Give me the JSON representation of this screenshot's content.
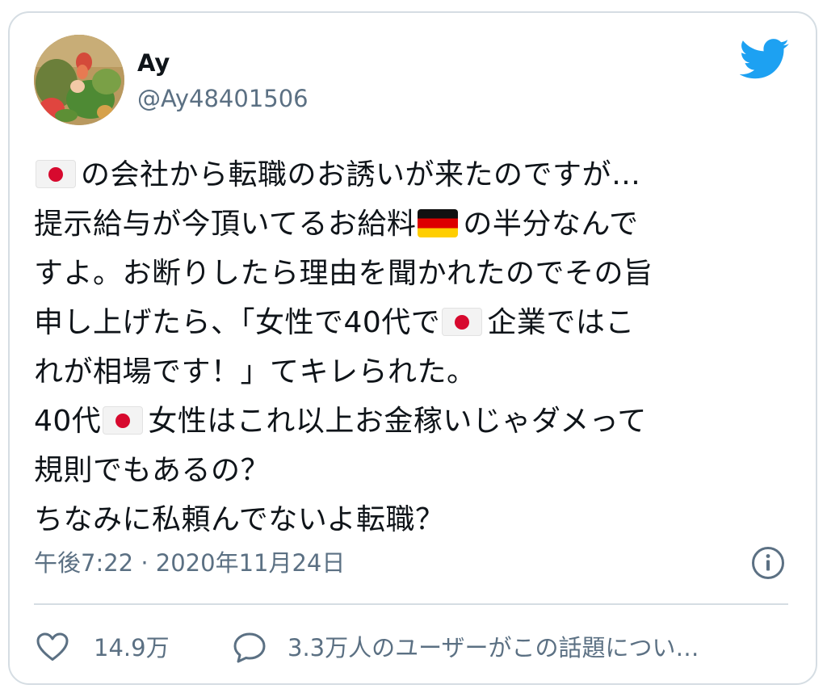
{
  "user": {
    "name": "Ay",
    "handle": "@Ay48401506"
  },
  "tweet": {
    "lines": [
      [
        "jp",
        "の会社から転職のお誘いが来たのですが…"
      ],
      [
        "",
        "提示給与が今頂いてるお給料",
        "de",
        "の半分なんで"
      ],
      [
        "",
        "すよ。お断りしたら理由を聞かれたのでその旨"
      ],
      [
        "",
        "申し上げたら、「女性で40代で",
        "jp",
        "企業ではこ"
      ],
      [
        "",
        "れが相場です！」てキレられた。"
      ],
      [
        "",
        "40代",
        "jp",
        "女性はこれ以上お金稼いじゃダメって"
      ],
      [
        "",
        "規則でもあるの？"
      ],
      [
        "",
        "ちなみに私頼んでないよ転職？"
      ]
    ],
    "timestamp": "午後7:22 · 2020年11月24日"
  },
  "actions": {
    "likes": "14.9万",
    "conversation": "3.3万人のユーザーがこの話題につい…"
  },
  "icons": {
    "brand": "twitter-bird-icon",
    "info": "info-icon",
    "like": "heart-icon",
    "reply": "speech-bubble-icon"
  },
  "colors": {
    "twitter_blue": "#1da1f2",
    "text": "#0f1419",
    "secondary": "#5b7083",
    "border": "#d5dde3"
  }
}
